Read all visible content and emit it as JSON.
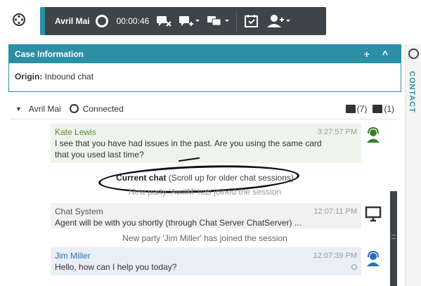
{
  "toolbar": {
    "agent_name": "Avril Mai",
    "timer": "00:00:46"
  },
  "case": {
    "title": "Case Information",
    "add_label": "+",
    "collapse_label": "^",
    "origin_label": "Origin:",
    "origin_value": "Inbound chat"
  },
  "rail": {
    "contact_label": "CONTACT"
  },
  "interaction": {
    "caret": "▼",
    "contact_name": "Avril Mai",
    "status": "Connected",
    "count_a": "(7)",
    "count_b": "(1)"
  },
  "transcript": {
    "messages": [
      {
        "sender": "Kate Lewis",
        "time": "3:27:57 PM",
        "text": "I see that you have had issues in the past. Are you using the same card that you used last time?"
      },
      {
        "sender": "Chat System",
        "time": "12:07:11 PM",
        "text": "Agent will be with you shortly (through Chat Server ChatServer) ..."
      },
      {
        "sender": "Jim Miller",
        "time": "12:07:39 PM",
        "text": "Hello, how can I help you today?"
      }
    ],
    "current_chat_bold": "Current chat",
    "current_chat_rest": " (Scroll up for older chat sessions)",
    "notice_party_1": "New party 'AvrilM' has joined the session",
    "notice_party_2": "New party 'Jim Miller' has joined the session"
  },
  "colors": {
    "accent": "#2b8fa6",
    "toolbar_bg": "#3f4448"
  }
}
